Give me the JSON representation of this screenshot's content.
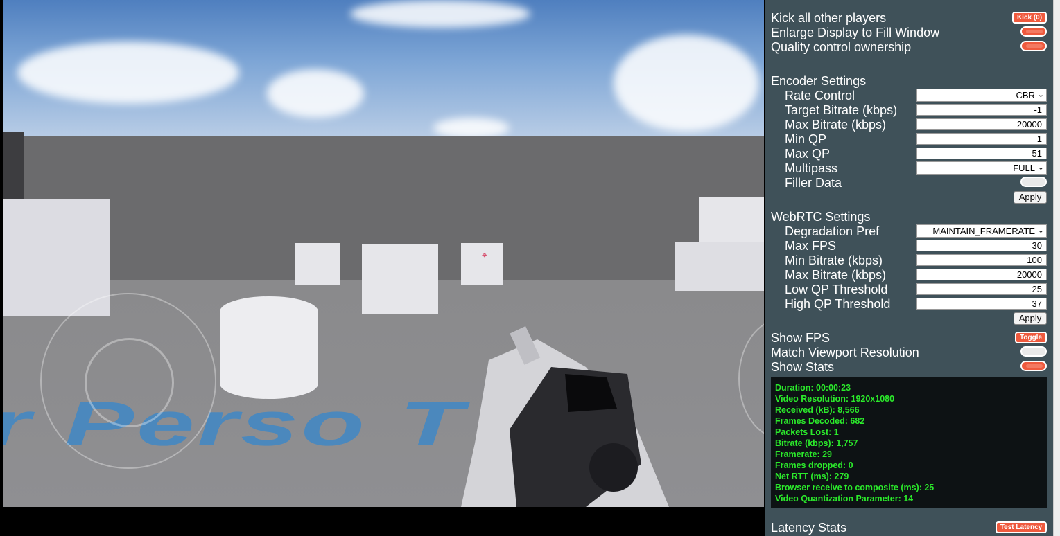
{
  "panel": {
    "kick_label": "Kick all other players",
    "kick_button": "Kick (0)",
    "enlarge_label": "Enlarge Display to Fill Window",
    "enlarge_on": true,
    "quality_label": "Quality control ownership",
    "quality_on": true,
    "encoder": {
      "title": "Encoder Settings",
      "rate_control_label": "Rate Control",
      "rate_control_value": "CBR",
      "target_bitrate_label": "Target Bitrate (kbps)",
      "target_bitrate_value": "-1",
      "max_bitrate_label": "Max Bitrate (kbps)",
      "max_bitrate_value": "20000",
      "min_qp_label": "Min QP",
      "min_qp_value": "1",
      "max_qp_label": "Max QP",
      "max_qp_value": "51",
      "multipass_label": "Multipass",
      "multipass_value": "FULL",
      "filler_label": "Filler Data",
      "filler_on": false,
      "apply_label": "Apply"
    },
    "webrtc": {
      "title": "WebRTC Settings",
      "degradation_label": "Degradation Pref",
      "degradation_value": "MAINTAIN_FRAMERATE",
      "max_fps_label": "Max FPS",
      "max_fps_value": "30",
      "min_bitrate_label": "Min Bitrate (kbps)",
      "min_bitrate_value": "100",
      "max_bitrate_label": "Max Bitrate (kbps)",
      "max_bitrate_value": "20000",
      "low_qp_label": "Low QP Threshold",
      "low_qp_value": "25",
      "high_qp_label": "High QP Threshold",
      "high_qp_value": "37",
      "apply_label": "Apply"
    },
    "show_fps_label": "Show FPS",
    "toggle_button": "Toggle",
    "match_viewport_label": "Match Viewport Resolution",
    "match_viewport_on": false,
    "show_stats_label": "Show Stats",
    "show_stats_on": true,
    "stats": [
      "Duration: 00:00:23",
      "Video Resolution: 1920x1080",
      "Received (kB): 8,566",
      "Frames Decoded: 682",
      "Packets Lost: 1",
      "Bitrate (kbps): 1,757",
      "Framerate: 29",
      "Frames dropped: 0",
      "Net RTT (ms): 279",
      "Browser receive to composite (ms): 25",
      "Video Quantization Parameter: 14"
    ],
    "latency_label": "Latency Stats",
    "test_latency_button": "Test Latency"
  },
  "game": {
    "floor_text": "r Perso   T",
    "crosshair": "⌖"
  }
}
